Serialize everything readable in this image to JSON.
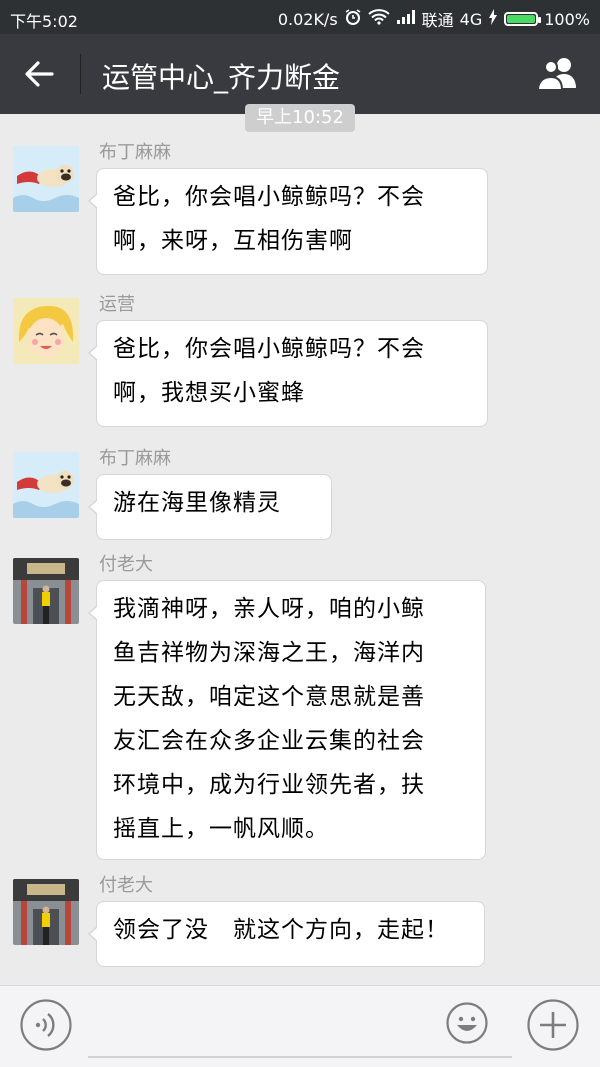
{
  "status_bar": {
    "time": "下午5:02",
    "speed": "0.02K/s",
    "carrier": "联通",
    "network": "4G",
    "battery": "100%",
    "battery_color": "#4cd964"
  },
  "header": {
    "title": "运管中心_齐力断金",
    "back_icon": "arrow-left-icon",
    "members_icon": "group-members-icon"
  },
  "timestamp": "早上10:52",
  "messages": [
    {
      "sender": "布丁麻麻",
      "lines": [
        "爸比，你会唱小鲸鲸吗？不会",
        "啊，来呀，互相伤害啊"
      ]
    },
    {
      "sender": "运营",
      "lines": [
        "爸比，你会唱小鲸鲸吗？不会",
        "啊，我想买小蜜蜂"
      ]
    },
    {
      "sender": "布丁麻麻",
      "lines": [
        "游在海里像精灵"
      ]
    },
    {
      "sender": "付老大",
      "lines": [
        "我滴神呀，亲人呀，咱的小鲸",
        "鱼吉祥物为深海之王，海洋内",
        "无天敌，咱定这个意思就是善",
        "友汇会在众多企业云集的社会",
        "环境中，成为行业领先者，扶",
        "摇直上，一帆风顺。"
      ]
    },
    {
      "sender": "付老大",
      "lines": [
        "领会了没　就这个方向，走起！"
      ]
    }
  ],
  "input_bar": {
    "voice_icon": "voice-icon",
    "emoji_icon": "emoji-icon",
    "plus_icon": "plus-icon",
    "text_value": ""
  },
  "colors": {
    "header_bg": "#393a3f",
    "statusbar_bg": "#2e3134",
    "chat_bg": "#ebebeb"
  }
}
